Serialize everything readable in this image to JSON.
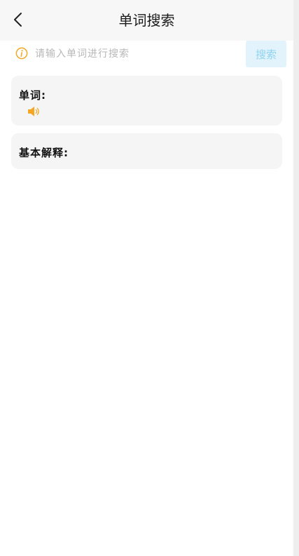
{
  "header": {
    "title": "单词搜索",
    "back_icon": "chevron-left-icon"
  },
  "search": {
    "placeholder": "请输入单词进行搜索",
    "value": "",
    "button_label": "搜索",
    "info_icon": "info-circle-icon"
  },
  "word_card": {
    "label": "单词:",
    "speaker_icon": "speaker-icon"
  },
  "meaning_card": {
    "label": "基本解释:"
  },
  "colors": {
    "accent": "#f5a623",
    "button_bg": "#e3f3fb",
    "button_text": "#8fd3f0",
    "card_bg": "#f5f5f5"
  }
}
